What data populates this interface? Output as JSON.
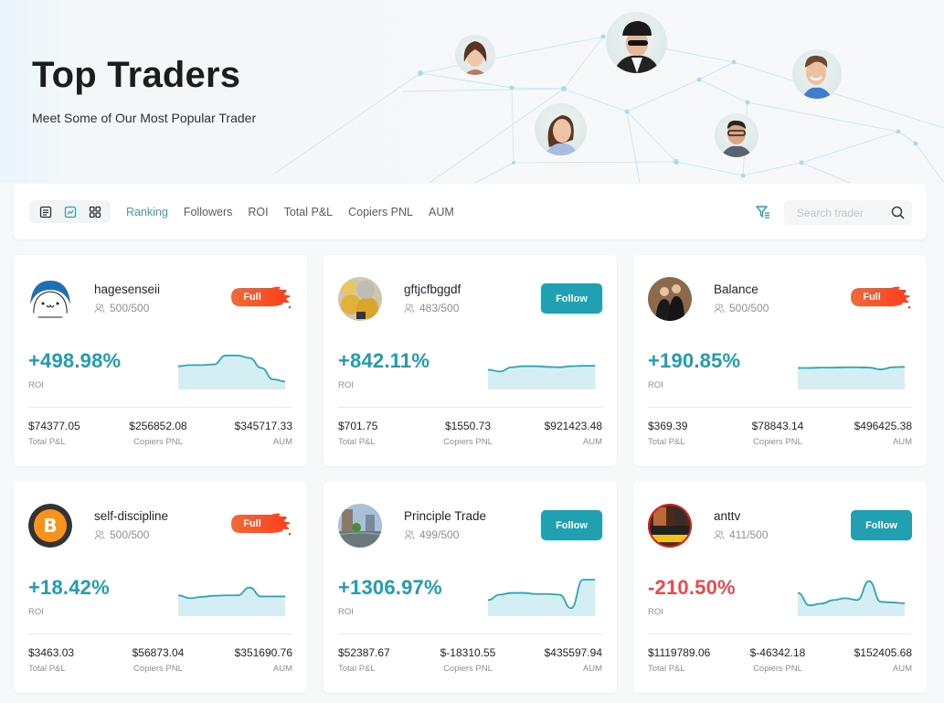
{
  "hero": {
    "title": "Top Traders",
    "subtitle": "Meet Some of Our Most Popular Trader",
    "featured_avatars": [
      "woman-smiling",
      "man-with-headphones",
      "man-smiling",
      "woman-long-hair",
      "man-with-glasses"
    ]
  },
  "toolbar": {
    "view_modes": [
      {
        "icon": "list-icon",
        "active": false
      },
      {
        "icon": "chart-icon",
        "active": true
      },
      {
        "icon": "grid-icon",
        "active": false
      }
    ],
    "sort_tabs": [
      {
        "label": "Ranking",
        "active": true
      },
      {
        "label": "Followers",
        "active": false
      },
      {
        "label": "ROI",
        "active": false
      },
      {
        "label": "Total P&L",
        "active": false
      },
      {
        "label": "Copiers PNL",
        "active": false
      },
      {
        "label": "AUM",
        "active": false
      }
    ],
    "filter_icon": "filter-icon",
    "search": {
      "placeholder": "Search trader",
      "value": ""
    }
  },
  "labels": {
    "roi": "ROI",
    "total_pnl": "Total P&L",
    "copiers_pnl": "Copiers PNL",
    "aum": "AUM",
    "follow": "Follow",
    "full": "Full"
  },
  "colors": {
    "accent": "#21a0b2",
    "positive": "#1f9db1",
    "negative": "#e84a4f",
    "full_badge": "#f4502a"
  },
  "traders": [
    {
      "name": "hagesenseii",
      "copiers": "500/500",
      "status": "full",
      "roi": "+498.98%",
      "roi_sign": "pos",
      "total_pnl": "$74377.05",
      "copiers_pnl": "$256852.08",
      "aum": "$345717.33",
      "avatar": "cartoon-seal",
      "trend": [
        0.55,
        0.58,
        0.58,
        0.6,
        0.85,
        0.85,
        0.78,
        0.5,
        0.18,
        0.12
      ]
    },
    {
      "name": "gftjcfbggdf",
      "copiers": "483/500",
      "status": "follow",
      "roi": "+842.11%",
      "roi_sign": "pos",
      "total_pnl": "$701.75",
      "copiers_pnl": "$1550.73",
      "aum": "$921423.48",
      "avatar": "gold-coins",
      "trend": [
        0.45,
        0.4,
        0.52,
        0.55,
        0.55,
        0.53,
        0.52,
        0.55,
        0.56,
        0.56
      ]
    },
    {
      "name": "Balance",
      "copiers": "500/500",
      "status": "full",
      "roi": "+190.85%",
      "roi_sign": "pos",
      "total_pnl": "$369.39",
      "copiers_pnl": "$78843.14",
      "aum": "$496425.38",
      "avatar": "two-men",
      "trend": [
        0.5,
        0.5,
        0.51,
        0.51,
        0.52,
        0.52,
        0.51,
        0.46,
        0.52,
        0.53
      ]
    },
    {
      "name": "self-discipline",
      "copiers": "500/500",
      "status": "full",
      "roi": "+18.42%",
      "roi_sign": "pos",
      "total_pnl": "$3463.03",
      "copiers_pnl": "$56873.04",
      "aum": "$351690.76",
      "avatar": "bitcoin-logo",
      "trend": [
        0.48,
        0.4,
        0.44,
        0.47,
        0.48,
        0.48,
        0.7,
        0.45,
        0.45,
        0.45
      ]
    },
    {
      "name": "Principle Trade",
      "copiers": "499/500",
      "status": "follow",
      "roi": "+1306.97%",
      "roi_sign": "pos",
      "total_pnl": "$52387.67",
      "copiers_pnl": "$-18310.55",
      "aum": "$435597.94",
      "avatar": "city-street",
      "trend": [
        0.35,
        0.5,
        0.55,
        0.55,
        0.52,
        0.52,
        0.5,
        0.12,
        0.92,
        0.92
      ]
    },
    {
      "name": "anttv",
      "copiers": "411/500",
      "status": "follow",
      "roi": "-210.50%",
      "roi_sign": "neg",
      "total_pnl": "$1119789.06",
      "copiers_pnl": "$-46342.18",
      "aum": "$152405.68",
      "avatar": "video-thumbnail",
      "trend": [
        0.55,
        0.2,
        0.25,
        0.35,
        0.4,
        0.35,
        0.88,
        0.3,
        0.28,
        0.26
      ]
    }
  ]
}
